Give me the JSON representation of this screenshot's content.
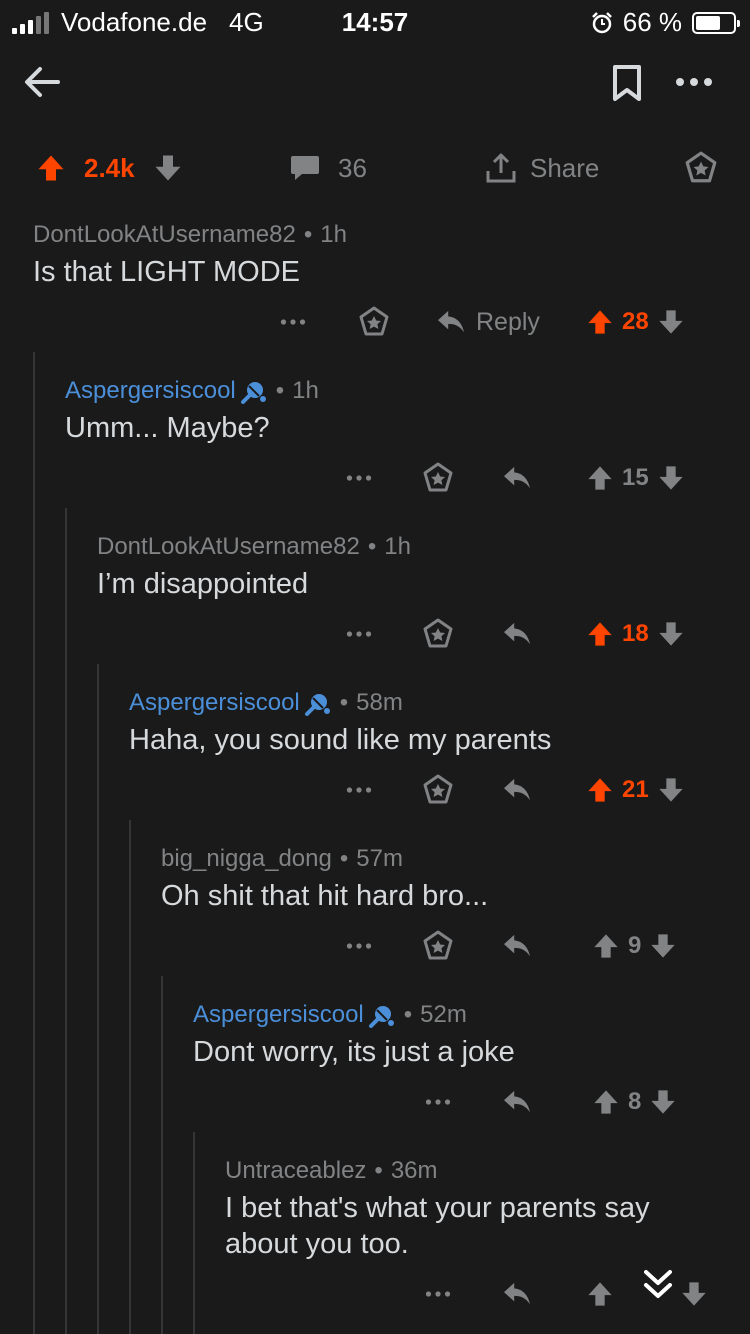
{
  "status_bar": {
    "carrier": "Vodafone.de",
    "network": "4G",
    "time": "14:57",
    "battery": "66 %",
    "battery_level": 0.66
  },
  "post_actions": {
    "score": "2.4k",
    "comment_count": "36",
    "share_label": "Share"
  },
  "colors": {
    "upvote_active": "#ff4500",
    "op_username": "#4b8fd9",
    "background": "#1a1a1b"
  },
  "icons": [
    "back-arrow-icon",
    "bookmark-icon",
    "more-icon",
    "upvote-icon",
    "downvote-icon",
    "comment-icon",
    "share-icon",
    "award-icon",
    "reply-icon",
    "microphone-icon",
    "chevron-down-icon"
  ],
  "comments": [
    {
      "author": "DontLookAtUsername82",
      "time": "1h",
      "body": "Is that LIGHT MODE",
      "score": "28",
      "reply_label": "Reply",
      "upvoted": true
    },
    {
      "author": "Aspergersiscool",
      "time": "1h",
      "body": "Umm... Maybe?",
      "score": "15",
      "upvoted": false
    },
    {
      "author": "DontLookAtUsername82",
      "time": "1h",
      "body": "I’m disappointed",
      "score": "18",
      "upvoted": true
    },
    {
      "author": "Aspergersiscool",
      "time": "58m",
      "body": "Haha, you sound like my parents",
      "score": "21",
      "upvoted": true
    },
    {
      "author": "big_nigga_dong",
      "time": "57m",
      "body": "Oh shit that hit hard bro...",
      "score": "9",
      "upvoted": false
    },
    {
      "author": "Aspergersiscool",
      "time": "52m",
      "body": "Dont worry, its just a joke",
      "score": "8",
      "upvoted": false
    },
    {
      "author": "Untraceablez",
      "time": "36m",
      "body_line1": "I bet that's what your parents say",
      "body_line2": "about you too.",
      "score": "",
      "upvoted": false
    }
  ]
}
